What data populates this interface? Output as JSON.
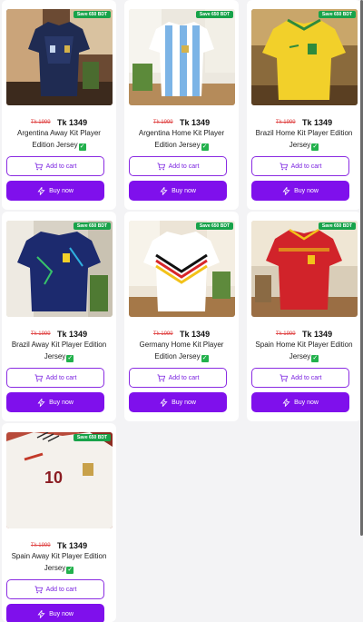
{
  "products": [
    {
      "badge": "Save 650 BDT",
      "old_price": "Tk 1999",
      "new_price": "Tk 1349",
      "title": "Argentina Away Kit Player Edition Jersey",
      "has_check": true,
      "cart_label": "Add to cart",
      "buy_label": "Buy now",
      "image_desc": "argentina-away-jersey-image"
    },
    {
      "badge": "Save 650 BDT",
      "old_price": "Tk 1999",
      "new_price": "Tk 1349",
      "title": "Argentina Home Kit Player Edition Jersey",
      "has_check": true,
      "cart_label": "Add to cart",
      "buy_label": "Buy now",
      "image_desc": "argentina-home-jersey-image"
    },
    {
      "badge": "Save 650 BDT",
      "old_price": "Tk 1999",
      "new_price": "Tk 1349",
      "title": "Brazil Home Kit Player Edition Jersey",
      "has_check": true,
      "cart_label": "Add to cart",
      "buy_label": "Buy now",
      "image_desc": "brazil-home-jersey-image"
    },
    {
      "badge": "Save 650 BDT",
      "old_price": "Tk 1999",
      "new_price": "Tk 1349",
      "title": "Brazil Away Kit Player Edition Jersey",
      "has_check": true,
      "cart_label": "Add to cart",
      "buy_label": "Buy now",
      "image_desc": "brazil-away-jersey-image"
    },
    {
      "badge": "Save 650 BDT",
      "old_price": "Tk 1999",
      "new_price": "Tk 1349",
      "title": "Germany Home Kit Player Edition Jersey",
      "has_check": true,
      "cart_label": "Add to cart",
      "buy_label": "Buy now",
      "image_desc": "germany-home-jersey-image"
    },
    {
      "badge": "Save 650 BDT",
      "old_price": "Tk 1999",
      "new_price": "Tk 1349",
      "title": "Spain Home Kit Player Edition Jersey",
      "has_check": true,
      "cart_label": "Add to cart",
      "buy_label": "Buy now",
      "image_desc": "spain-home-jersey-image"
    },
    {
      "badge": "Save 650 BDT",
      "old_price": "Tk 1999",
      "new_price": "Tk 1349",
      "title": "Spain Away Kit Player Edition Jersey",
      "has_check": true,
      "cart_label": "Add to cart",
      "buy_label": "Buy now",
      "image_desc": "spain-away-jersey-image"
    }
  ],
  "colors": {
    "accent": "#7f10ec",
    "badge": "#18a34a",
    "old_price": "#e04848",
    "check": "#22b14c"
  },
  "icons": {
    "cart": "cart-icon",
    "buy": "lightning-icon",
    "check": "check-icon"
  }
}
